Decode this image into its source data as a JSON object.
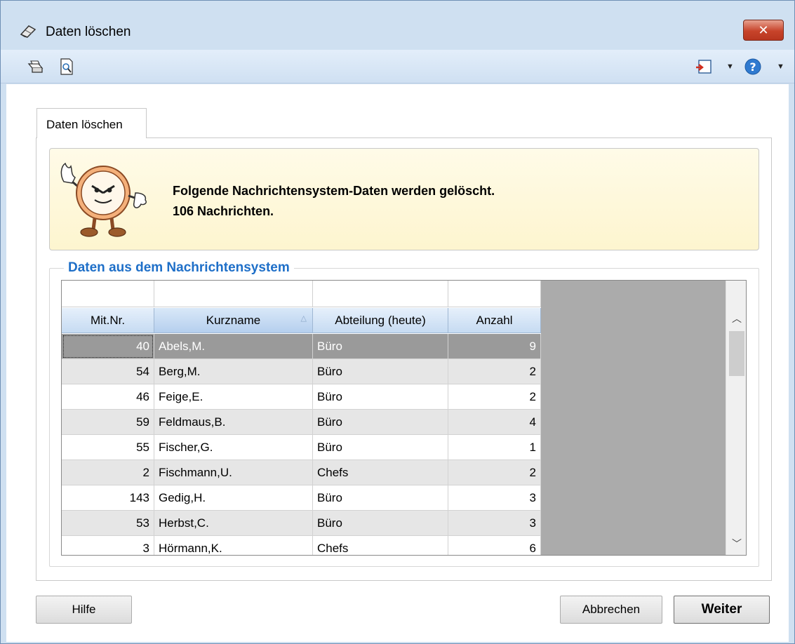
{
  "window": {
    "title": "Daten löschen",
    "close_label": "✕",
    "accent_color": "#1e6fc8",
    "title_icon": "eraser-icon"
  },
  "toolbar": {
    "left_icons": [
      "print-icon",
      "print-preview-icon"
    ],
    "right_icons": [
      "exit-icon",
      "help-icon"
    ]
  },
  "tabs": [
    {
      "label": "Daten löschen",
      "active": true
    }
  ],
  "info": {
    "line1": "Folgende Nachrichtensystem-Daten werden gelöscht.",
    "line2": "106 Nachrichten.",
    "mascot_icon": "clock-mascot-icon"
  },
  "group": {
    "label": "Daten aus dem Nachrichtensystem"
  },
  "table": {
    "columns": [
      "Mit.Nr.",
      "Kurzname",
      "Abteilung (heute)",
      "Anzahl"
    ],
    "sorted_column": "Kurzname",
    "selected_row": 0,
    "rows": [
      {
        "nr": "40",
        "name": "Abels,M.",
        "abteilung": "Büro",
        "anzahl": "9"
      },
      {
        "nr": "54",
        "name": "Berg,M.",
        "abteilung": "Büro",
        "anzahl": "2"
      },
      {
        "nr": "46",
        "name": "Feige,E.",
        "abteilung": "Büro",
        "anzahl": "2"
      },
      {
        "nr": "59",
        "name": "Feldmaus,B.",
        "abteilung": "Büro",
        "anzahl": "4"
      },
      {
        "nr": "55",
        "name": "Fischer,G.",
        "abteilung": "Büro",
        "anzahl": "1"
      },
      {
        "nr": "2",
        "name": "Fischmann,U.",
        "abteilung": "Chefs",
        "anzahl": "2"
      },
      {
        "nr": "143",
        "name": "Gedig,H.",
        "abteilung": "Büro",
        "anzahl": "3"
      },
      {
        "nr": "53",
        "name": "Herbst,C.",
        "abteilung": "Büro",
        "anzahl": "3"
      },
      {
        "nr": "3",
        "name": "Hörmann,K.",
        "abteilung": "Chefs",
        "anzahl": "6"
      }
    ]
  },
  "buttons": {
    "hilfe": "Hilfe",
    "abbrechen": "Abbrechen",
    "weiter": "Weiter"
  }
}
